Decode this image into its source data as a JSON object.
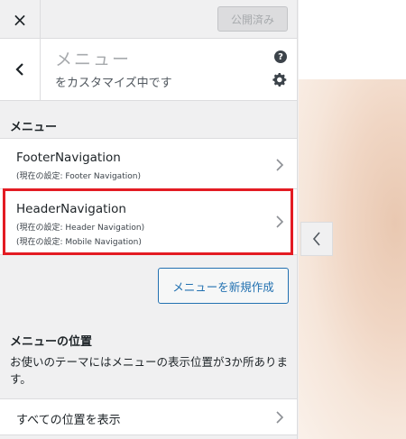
{
  "topbar": {
    "close_label": "×",
    "publish_label": "公開済み"
  },
  "section_header": {
    "title": "メニュー",
    "subtitle": "をカスタマイズ中です"
  },
  "menus_label": "メニュー",
  "menus": [
    {
      "name": "FooterNavigation",
      "locations": [
        "(現在の設定: Footer Navigation)"
      ]
    },
    {
      "name": "HeaderNavigation",
      "locations": [
        "(現在の設定: Header Navigation)",
        "(現在の設定: Mobile Navigation)"
      ]
    }
  ],
  "new_menu_label": "メニューを新規作成",
  "locations_section": {
    "title": "メニューの位置",
    "description": "お使いのテーマにはメニューの表示位置が3か所あります。",
    "view_all_label": "すべての位置を表示"
  },
  "icons": {
    "help": "?",
    "settings": "gear-icon",
    "back": "chevron-left-icon"
  },
  "colors": {
    "accent": "#2271b1",
    "highlight": "#e31b23"
  }
}
